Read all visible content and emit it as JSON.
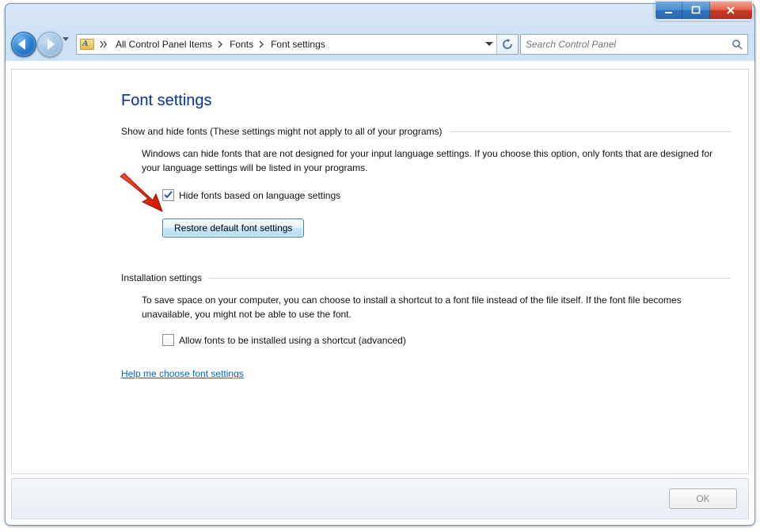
{
  "breadcrumb": {
    "item0": "All Control Panel Items",
    "item1": "Fonts",
    "item2": "Font settings"
  },
  "search": {
    "placeholder": "Search Control Panel"
  },
  "page": {
    "title": "Font settings"
  },
  "group1": {
    "legend": "Show and hide fonts (These settings might not apply to all of your programs)",
    "desc": "Windows can hide fonts that are not designed for your input language settings. If you choose this option, only fonts that are designed for your language settings will be listed in your programs.",
    "checkbox_label": "Hide fonts based on language settings",
    "restore_label": "Restore default font settings"
  },
  "group2": {
    "legend": "Installation settings",
    "desc": "To save space on your computer, you can choose to install a shortcut to a font file instead of the file itself. If the font file becomes unavailable, you might not be able to use the font.",
    "checkbox_label": "Allow fonts to be installed using a shortcut (advanced)"
  },
  "help_link": "Help me choose font settings",
  "footer": {
    "ok_label": "OK"
  }
}
